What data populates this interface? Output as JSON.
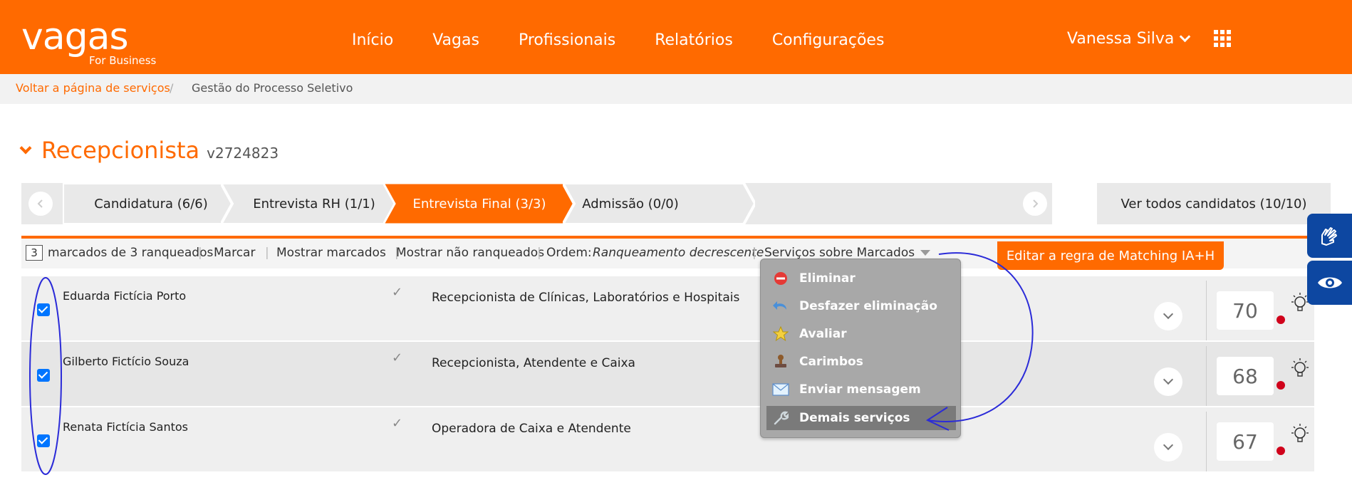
{
  "header": {
    "logo_main": "vagas",
    "logo_sub": "For Business",
    "nav": [
      "Início",
      "Vagas",
      "Profissionais",
      "Relatórios",
      "Configurações"
    ],
    "user_name": "Vanessa Silva"
  },
  "breadcrumb": {
    "back_link": "Voltar a página de serviços",
    "separator": "/",
    "current": "Gestão do Processo Seletivo"
  },
  "job": {
    "title": "Recepcionista",
    "code": "v2724823"
  },
  "pipeline": {
    "stages": [
      {
        "label": "Candidatura (6/6)",
        "active": false
      },
      {
        "label": "Entrevista RH (1/1)",
        "active": false
      },
      {
        "label": "Entrevista Final (3/3)",
        "active": true
      },
      {
        "label": "Admissão (0/0)",
        "active": false
      }
    ],
    "view_all": "Ver todos candidatos (10/10)"
  },
  "toolbar": {
    "marked_count": "3",
    "marked_text": "marcados de 3 ranqueados",
    "separator": "|",
    "mark": "Marcar",
    "show_marked": "Mostrar marcados",
    "show_unranked": "Mostrar não ranqueados",
    "order_label": "Ordem:",
    "order_value": "Ranqueamento decrescente",
    "services": "Serviços sobre Marcados",
    "matching_button": "Editar a regra de Matching IA+H"
  },
  "candidates": [
    {
      "name": "Eduarda Fictícia Porto",
      "title": "Recepcionista de Clínicas, Laboratórios e Hospitais",
      "score": "70",
      "checked": true
    },
    {
      "name": "Gilberto Fictício Souza",
      "title": "Recepcionista, Atendente e Caixa",
      "score": "68",
      "checked": true
    },
    {
      "name": "Renata Fictícia Santos",
      "title": "Operadora de Caixa e Atendente",
      "score": "67",
      "checked": true
    }
  ],
  "services_menu": {
    "items": [
      {
        "label": "Eliminar",
        "icon": "remove-icon"
      },
      {
        "label": "Desfazer eliminação",
        "icon": "undo-icon"
      },
      {
        "label": "Avaliar",
        "icon": "star-icon"
      },
      {
        "label": "Carimbos",
        "icon": "stamp-icon"
      },
      {
        "label": "Enviar mensagem",
        "icon": "envelope-icon"
      },
      {
        "label": "Demais serviços",
        "icon": "wrench-icon"
      }
    ],
    "highlighted_index": 5
  },
  "colors": {
    "brand": "#ff6a00",
    "menu_bg": "#a8a8a8",
    "accessibility": "#0d47a1",
    "annotation": "#2b2bd8"
  }
}
